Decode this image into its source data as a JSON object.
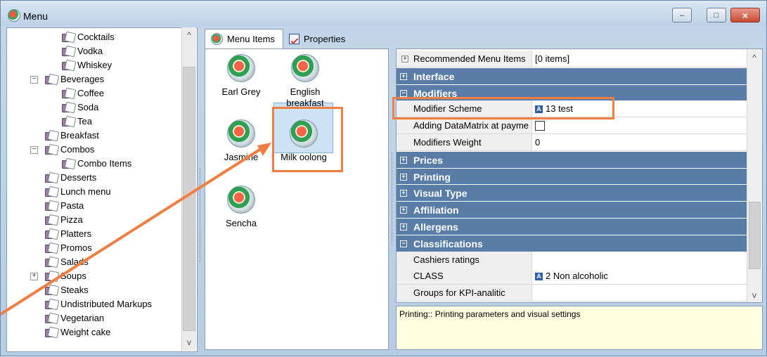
{
  "window": {
    "title": "Menu",
    "buttons": {
      "minimize": "–",
      "maximize": "□",
      "close": "×"
    }
  },
  "tree": {
    "items": [
      {
        "label": "Cocktails",
        "level": 2,
        "expander": ""
      },
      {
        "label": "Vodka",
        "level": 2,
        "expander": ""
      },
      {
        "label": "Whiskey",
        "level": 2,
        "expander": ""
      },
      {
        "label": "Beverages",
        "level": 1,
        "expander": "−"
      },
      {
        "label": "Coffee",
        "level": 2,
        "expander": ""
      },
      {
        "label": "Soda",
        "level": 2,
        "expander": ""
      },
      {
        "label": "Tea",
        "level": 2,
        "expander": ""
      },
      {
        "label": "Breakfast",
        "level": 1,
        "expander": ""
      },
      {
        "label": "Combos",
        "level": 1,
        "expander": "−"
      },
      {
        "label": "Combo Items",
        "level": 2,
        "expander": ""
      },
      {
        "label": "Desserts",
        "level": 1,
        "expander": ""
      },
      {
        "label": "Lunch menu",
        "level": 1,
        "expander": ""
      },
      {
        "label": "Pasta",
        "level": 1,
        "expander": ""
      },
      {
        "label": "Pizza",
        "level": 1,
        "expander": ""
      },
      {
        "label": "Platters",
        "level": 1,
        "expander": ""
      },
      {
        "label": "Promos",
        "level": 1,
        "expander": ""
      },
      {
        "label": "Salads",
        "level": 1,
        "expander": ""
      },
      {
        "label": "Soups",
        "level": 1,
        "expander": "+"
      },
      {
        "label": "Steaks",
        "level": 1,
        "expander": ""
      },
      {
        "label": "Undistributed Markups",
        "level": 1,
        "expander": ""
      },
      {
        "label": "Vegetarian",
        "level": 1,
        "expander": ""
      },
      {
        "label": "Weight cake",
        "level": 1,
        "expander": ""
      }
    ],
    "scroll_up": "^",
    "scroll_down": "v"
  },
  "tabs": [
    {
      "label": "Menu Items",
      "icon": "menu-item-icon"
    },
    {
      "label": "Properties",
      "icon": "properties-icon"
    }
  ],
  "menu_items": [
    {
      "label": "Earl Grey"
    },
    {
      "label": "English breakfast"
    },
    {
      "label": "Jasmine"
    },
    {
      "label": "Milk oolong"
    },
    {
      "label": "Sencha"
    }
  ],
  "properties": {
    "rows": [
      {
        "type": "property",
        "name": "Recommended Menu Items",
        "value": "[0 items]",
        "mark": "+"
      },
      {
        "type": "section",
        "name": "Interface",
        "mark": "+"
      },
      {
        "type": "section",
        "name": "Modifiers",
        "mark": "−"
      },
      {
        "type": "property",
        "name": "Modifier Scheme",
        "value": "13 test",
        "badge": "A"
      },
      {
        "type": "property",
        "name": "Adding DataMatrix at payme",
        "value": "",
        "checkbox": true
      },
      {
        "type": "property",
        "name": "Modifiers Weight",
        "value": "0"
      },
      {
        "type": "section",
        "name": "Prices",
        "mark": "+"
      },
      {
        "type": "section",
        "name": "Printing",
        "mark": "+"
      },
      {
        "type": "section",
        "name": "Visual Type",
        "mark": "+"
      },
      {
        "type": "section",
        "name": "Affiliation",
        "mark": "+"
      },
      {
        "type": "section",
        "name": "Allergens",
        "mark": "+"
      },
      {
        "type": "section",
        "name": "Classifications",
        "mark": "−"
      },
      {
        "type": "property",
        "name": "Cashiers ratings",
        "value": ""
      },
      {
        "type": "property",
        "name": "CLASS",
        "value": "2 Non alcoholic",
        "badge": "A"
      },
      {
        "type": "property",
        "name": "Groups for KPI-analitic",
        "value": ""
      }
    ],
    "scroll_up": "^",
    "scroll_down": "v"
  },
  "description": {
    "text": "Printing:: Printing parameters and visual settings"
  },
  "colors": {
    "section_header": "#5a7da8",
    "highlight": "#f07e43",
    "description_bg": "#ffffe2"
  }
}
